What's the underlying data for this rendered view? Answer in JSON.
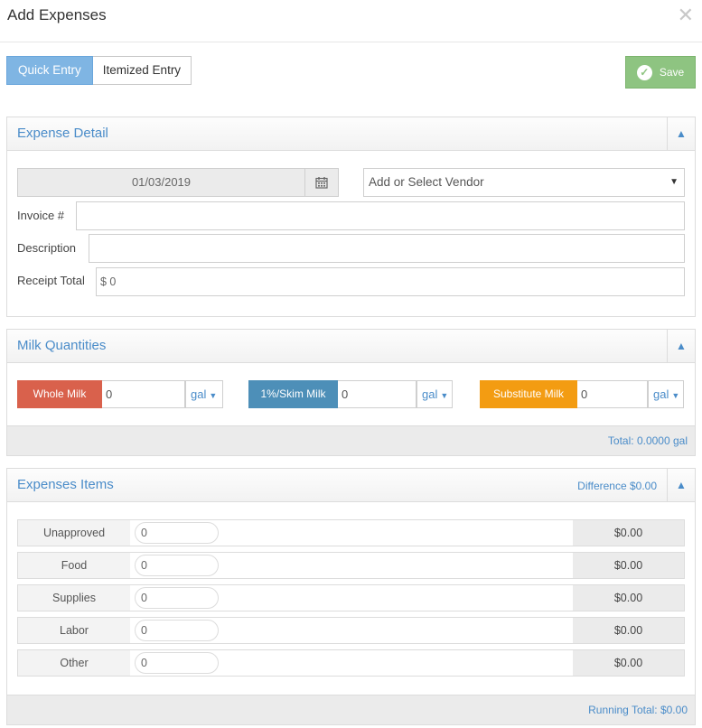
{
  "header": {
    "title": "Add Expenses",
    "close": "✕"
  },
  "mode_toggle": {
    "quick": "Quick Entry",
    "itemized": "Itemized Entry"
  },
  "save_label": "Save",
  "expense_detail": {
    "title": "Expense Detail",
    "date": "01/03/2019",
    "vendor_placeholder": "Add or Select Vendor",
    "invoice_label": "Invoice #",
    "invoice_value": "",
    "description_label": "Description",
    "description_value": "",
    "receipt_label": "Receipt Total",
    "receipt_value": "$ 0"
  },
  "milk": {
    "title": "Milk Quantities",
    "items": [
      {
        "label": "Whole Milk",
        "value": "0",
        "unit": "gal",
        "color": "#d9614c"
      },
      {
        "label": "1%/Skim Milk",
        "value": "0",
        "unit": "gal",
        "color": "#4d8fb8"
      },
      {
        "label": "Substitute Milk",
        "value": "0",
        "unit": "gal",
        "color": "#f39c12"
      }
    ],
    "total": "Total: 0.0000 gal"
  },
  "expenses": {
    "title": "Expenses Items",
    "difference": "Difference $0.00",
    "rows": [
      {
        "name": "Unapproved",
        "value": "0",
        "amount": "$0.00"
      },
      {
        "name": "Food",
        "value": "0",
        "amount": "$0.00"
      },
      {
        "name": "Supplies",
        "value": "0",
        "amount": "$0.00"
      },
      {
        "name": "Labor",
        "value": "0",
        "amount": "$0.00"
      },
      {
        "name": "Other",
        "value": "0",
        "amount": "$0.00"
      }
    ],
    "running_total": "Running Total: $0.00"
  }
}
